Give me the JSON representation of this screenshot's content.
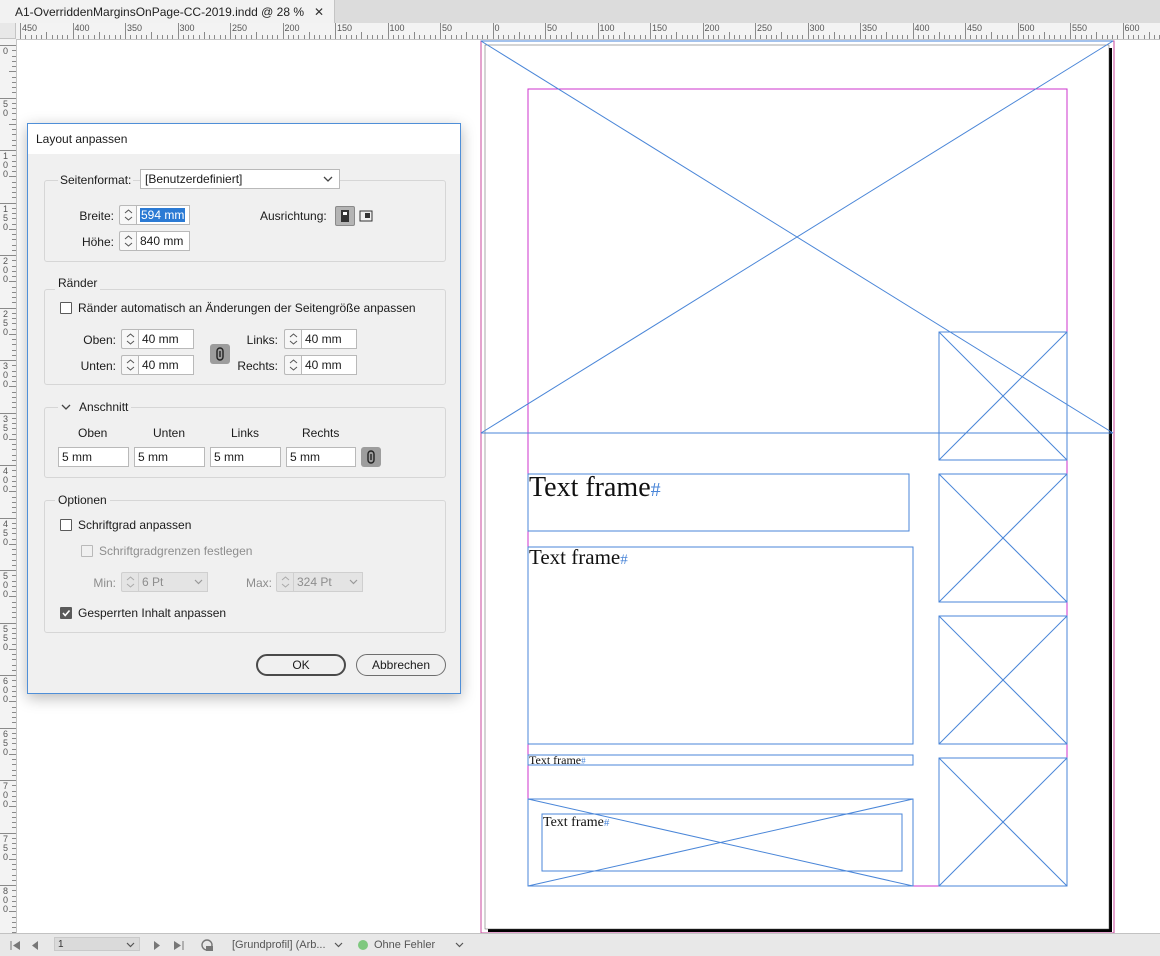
{
  "document_tab": {
    "title": "A1-OverriddenMarginsOnPage-CC-2019.indd @ 28 %",
    "close_symbol": "✕"
  },
  "ruler": {
    "h_labels": [
      "450",
      "400",
      "350",
      "300",
      "250",
      "200",
      "150",
      "100",
      "50",
      "0",
      "50",
      "100",
      "150",
      "200",
      "250",
      "300",
      "350",
      "400",
      "450",
      "500",
      "550",
      "600"
    ],
    "v_labels": [
      "0",
      "50",
      "100",
      "150",
      "200",
      "250",
      "300",
      "350",
      "400",
      "450",
      "500",
      "550",
      "600",
      "650",
      "700",
      "750",
      "800"
    ]
  },
  "canvas": {
    "text_frames": [
      {
        "label": "Text frame",
        "marker": "#"
      },
      {
        "label": "Text frame",
        "marker": "#"
      },
      {
        "label": "Text frame",
        "marker": "#"
      },
      {
        "label": "Text frame",
        "marker": "#"
      }
    ],
    "colors": {
      "margin_guide": "#cc33cc",
      "frame_stroke": "#4a86d8",
      "page_border": "#c8479c"
    }
  },
  "dialog": {
    "title": "Layout anpassen",
    "seitenformat": {
      "label": "Seitenformat:",
      "value": "[Benutzerdefiniert]"
    },
    "breite": {
      "label": "Breite:",
      "value": "594 mm"
    },
    "hoehe": {
      "label": "Höhe:",
      "value": "840 mm"
    },
    "ausrichtung": {
      "label": "Ausrichtung:"
    },
    "raender": {
      "title": "Ränder",
      "auto_label": "Ränder automatisch an Änderungen der Seitengröße anpassen",
      "auto_checked": false,
      "oben": {
        "label": "Oben:",
        "value": "40 mm"
      },
      "unten": {
        "label": "Unten:",
        "value": "40 mm"
      },
      "links": {
        "label": "Links:",
        "value": "40 mm"
      },
      "rechts": {
        "label": "Rechts:",
        "value": "40 mm"
      }
    },
    "anschnitt": {
      "title": "Anschnitt",
      "headers": [
        "Oben",
        "Unten",
        "Links",
        "Rechts"
      ],
      "values": [
        "5 mm",
        "5 mm",
        "5 mm",
        "5 mm"
      ]
    },
    "optionen": {
      "title": "Optionen",
      "schriftgrad_label": "Schriftgrad anpassen",
      "schriftgrad_checked": false,
      "grenzen_label": "Schriftgradgrenzen festlegen",
      "grenzen_checked": false,
      "min": {
        "label": "Min:",
        "value": "6 Pt"
      },
      "max": {
        "label": "Max:",
        "value": "324 Pt"
      },
      "gesperrt_label": "Gesperrten Inhalt anpassen",
      "gesperrt_checked": true
    },
    "ok_label": "OK",
    "cancel_label": "Abbrechen"
  },
  "statusbar": {
    "page_number": "1",
    "profile": "[Grundprofil] (Arb...",
    "preflight": "Ohne Fehler",
    "preflight_color": "#7ec87e"
  }
}
